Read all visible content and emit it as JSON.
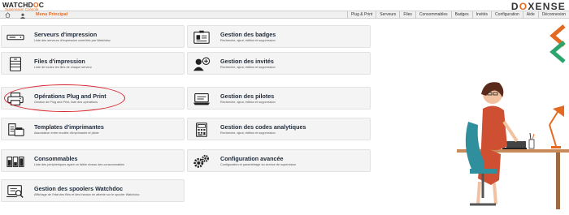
{
  "brand": {
    "name_part1": "WATCHD",
    "name_accent": "O",
    "name_part2": "C",
    "subtitle": "Supervision Console"
  },
  "logo": {
    "part1": "D",
    "accent": "O",
    "part2": "XENSE"
  },
  "nav": {
    "menu_label": "Menu Principal",
    "items": [
      "Plug & Print",
      "Serveurs",
      "Files",
      "Consommables",
      "Badges",
      "Invités",
      "Configuration",
      "Aide",
      "Déconnexion"
    ]
  },
  "cards": [
    {
      "title": "Serveurs d'impression",
      "desc": "Liste des serveurs d'impression contrôlés par Watchdoc",
      "icon": "server-icon"
    },
    {
      "title": "Gestion des badges",
      "desc": "Recherche, ajout, édition et suppression",
      "icon": "badge-icon"
    },
    {
      "title": "Files d'impression",
      "desc": "Liste de toutes les files de chaque serveur",
      "icon": "print-queue-icon"
    },
    {
      "title": "Gestion des invités",
      "desc": "Recherche, ajout, édition et suppression",
      "icon": "add-user-icon"
    },
    {
      "title": "Opérations Plug and Print",
      "desc": "Gestion de Plug and Print, liste des opérations",
      "icon": "printer-icon"
    },
    {
      "title": "Gestion des pilotes",
      "desc": "Recherche, ajout, édition et suppression",
      "icon": "laptop-icon"
    },
    {
      "title": "Templates d'imprimantes",
      "desc": "Association entre modèle d'imprimante et pilote",
      "icon": "printer-template-icon"
    },
    {
      "title": "Gestion des codes analytiques",
      "desc": "Recherche, ajout, édition et suppression",
      "icon": "calculator-icon"
    },
    {
      "title": "Consommables",
      "desc": "Liste des périphériques ayant un faible niveau des consommables",
      "icon": "toner-icon"
    },
    {
      "title": "Configuration avancée",
      "desc": "Configuration et paramétrage du service de supervision",
      "icon": "gears-icon"
    },
    {
      "title": "Gestion des spoolers Watchdoc",
      "desc": "Affichage de l'état des files et des travaux en attente sur le spooler Watchdoc",
      "icon": "spooler-icon"
    }
  ],
  "colors": {
    "accent": "#e46a22",
    "highlight": "#d9232d",
    "card_bg": "#f4f4f4",
    "title": "#1f2a3a"
  }
}
